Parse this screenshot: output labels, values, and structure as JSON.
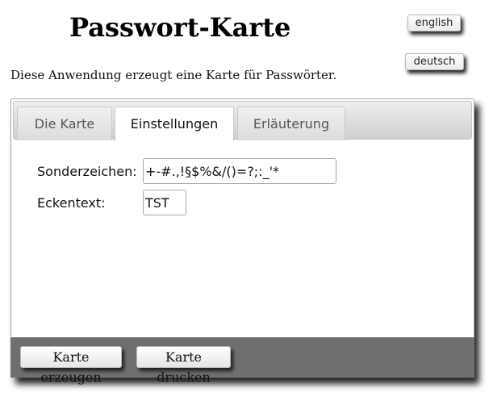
{
  "header": {
    "title": "Passwort-Karte",
    "intro": "Diese Anwendung erzeugt eine Karte für Passwörter."
  },
  "language": {
    "english_label": "english",
    "german_label": "deutsch"
  },
  "tabs": [
    {
      "label": "Die Karte",
      "active": false
    },
    {
      "label": "Einstellungen",
      "active": true
    },
    {
      "label": "Erläuterung",
      "active": false
    }
  ],
  "settings": {
    "special_chars_label": "Sonderzeichen:",
    "special_chars_value": "+-#.,!§$%&/()=?;:_'*",
    "corner_text_label": "Eckentext:",
    "corner_text_value": "TST"
  },
  "actions": {
    "generate_label": "Karte erzeugen",
    "print_label": "Karte drucken"
  }
}
